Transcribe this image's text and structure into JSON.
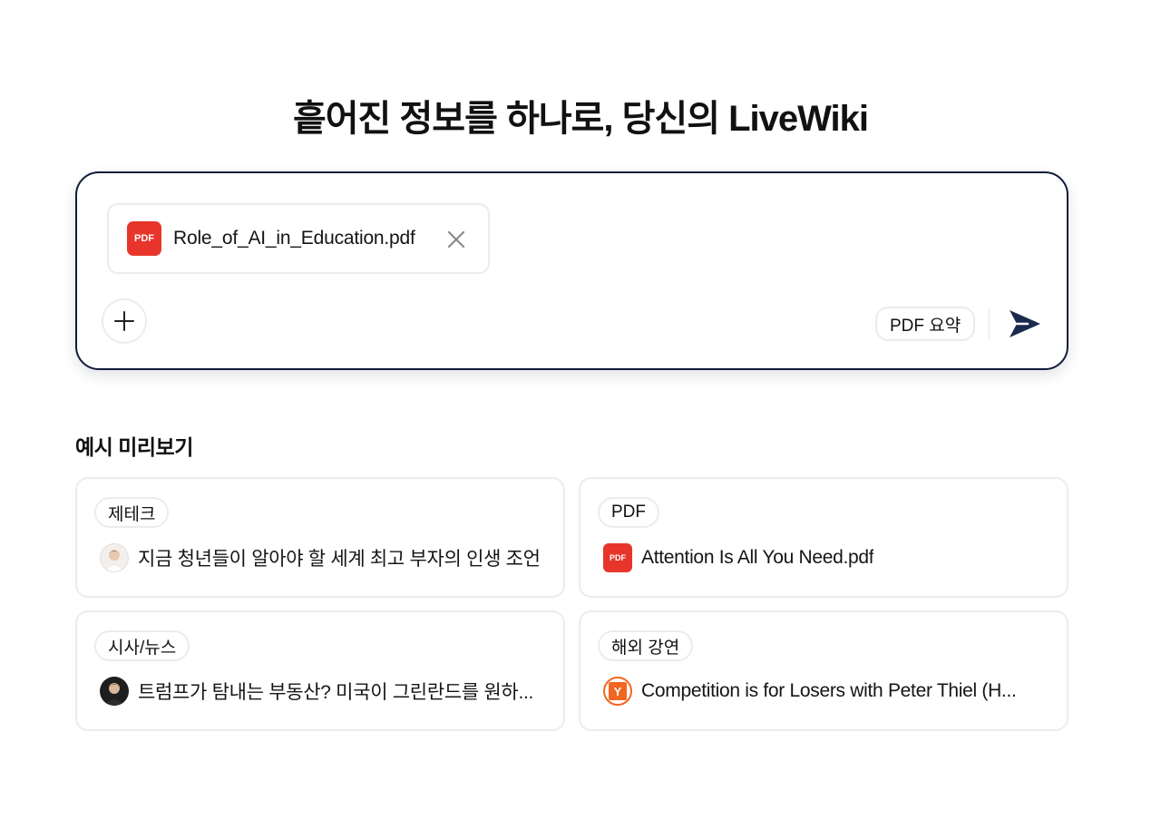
{
  "header": {
    "title": "흩어진 정보를 하나로, 당신의 LiveWiki"
  },
  "composer": {
    "attachment": {
      "type_label": "PDF",
      "filename": "Role_of_AI_in_Education.pdf"
    },
    "mode_label": "PDF 요약",
    "icons": {
      "add": "plus-icon",
      "remove": "close-icon",
      "send": "send-arrow-icon"
    },
    "accent_color": "#0f1c3a"
  },
  "examples": {
    "title": "예시 미리보기",
    "cards": [
      {
        "tag": "제테크",
        "title": "지금 청년들이 알아야 할 세계 최고 부자의 인생 조언",
        "icon": "avatar-light"
      },
      {
        "tag": "PDF",
        "title": "Attention Is All You Need.pdf",
        "icon": "pdf-icon",
        "icon_label": "PDF"
      },
      {
        "tag": "시사/뉴스",
        "title": "트럼프가 탐내는 부동산? 미국이 그린란드를 원하...",
        "icon": "avatar-dark"
      },
      {
        "tag": "해외 강연",
        "title": "Competition is for Losers with Peter Thiel (H...",
        "icon": "yc-logo",
        "icon_label": "Y"
      }
    ]
  },
  "colors": {
    "pdf_red": "#e8352b",
    "yc_orange": "#f26522",
    "border": "#ececec"
  }
}
